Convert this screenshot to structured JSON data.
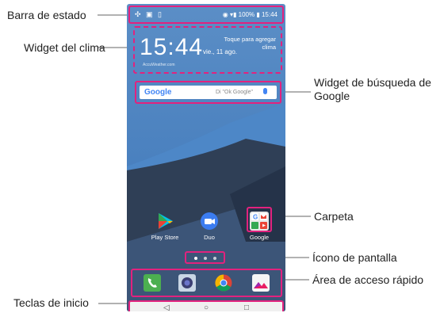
{
  "callouts": {
    "status_bar": "Barra de estado",
    "weather_widget": "Widget del clima",
    "search_widget_line1": "Widget de búsqueda de",
    "search_widget_line2": "Google",
    "folder": "Carpeta",
    "screen_icon": "Ícono de pantalla",
    "quick_access": "Área de acceso rápido",
    "home_keys": "Teclas de inicio"
  },
  "status_bar": {
    "left_icons": [
      "usb-icon",
      "image-icon",
      "sim-icon"
    ],
    "right_text": "100%",
    "time": "15:44"
  },
  "weather": {
    "time": "15:44",
    "date": "vie., 11 ago.",
    "hint": "Toque para agregar clima",
    "source": "AccuWeather.com"
  },
  "search": {
    "logo": "Google",
    "hint": "Di \"Ok Google\""
  },
  "apps": [
    {
      "label": "Play Store",
      "icon": "play-store-icon"
    },
    {
      "label": "Duo",
      "icon": "duo-icon"
    },
    {
      "label": "Google",
      "icon": "google-folder-icon"
    }
  ],
  "dock": [
    "phone-icon",
    "camera-icon",
    "chrome-icon",
    "gallery-icon"
  ],
  "nav": {
    "back": "◁",
    "home": "○",
    "recents": "□"
  },
  "colors": {
    "highlight": "#e2227e"
  }
}
